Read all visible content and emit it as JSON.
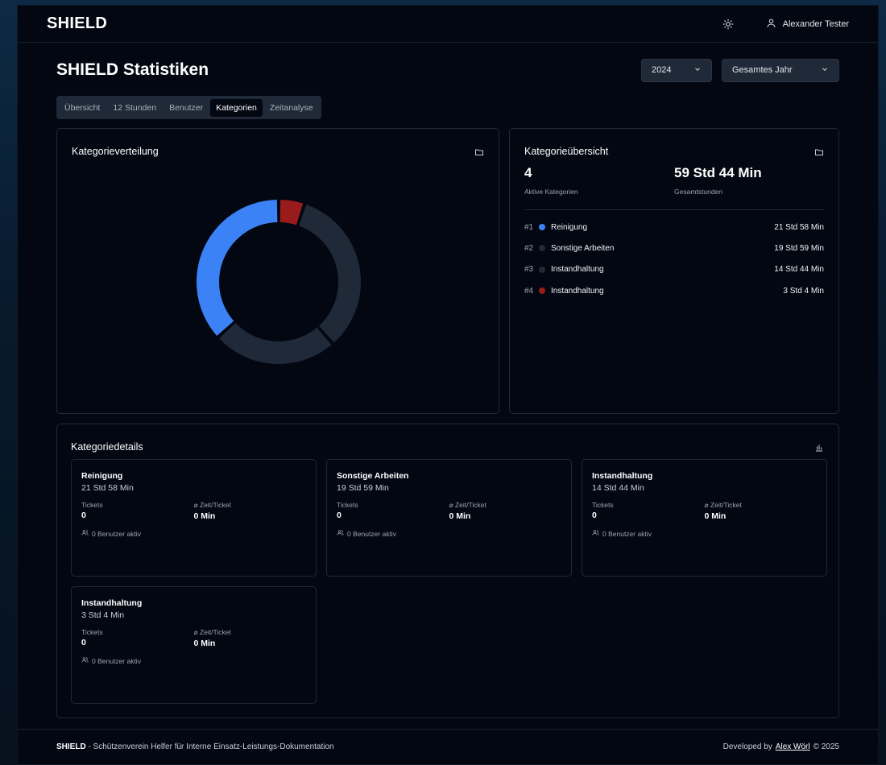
{
  "header": {
    "brand": "SHIELD",
    "user_name": "Alexander Tester"
  },
  "page": {
    "title": "SHIELD Statistiken"
  },
  "filters": {
    "year": "2024",
    "range": "Gesamtes Jahr"
  },
  "tabs": [
    {
      "label": "Übersicht"
    },
    {
      "label": "12 Stunden"
    },
    {
      "label": "Benutzer"
    },
    {
      "label": "Kategorien"
    },
    {
      "label": "Zeitanalyse"
    }
  ],
  "distribution": {
    "title": "Kategorieverteilung"
  },
  "overview": {
    "title": "Kategorieübersicht",
    "active_count": "4",
    "active_label": "Aktive Kategorien",
    "total_time": "59 Std 44 Min",
    "total_label": "Gesamtstunden",
    "items": [
      {
        "rank": "#1",
        "name": "Reinigung",
        "time": "21 Std 58 Min"
      },
      {
        "rank": "#2",
        "name": "Sonstige Arbeiten",
        "time": "19 Std 59 Min"
      },
      {
        "rank": "#3",
        "name": "Instandhaltung",
        "time": "14 Std 44 Min"
      },
      {
        "rank": "#4",
        "name": "Instandhaltung",
        "time": "3 Std 4 Min"
      }
    ]
  },
  "details": {
    "title": "Kategoriedetails",
    "tickets_label": "Tickets",
    "avg_label": "⌀ Zeit/Ticket",
    "cards": [
      {
        "name": "Reinigung",
        "time": "21 Std 58 Min",
        "tickets": "0",
        "avg": "0 Min",
        "users": "0 Benutzer aktiv"
      },
      {
        "name": "Sonstige Arbeiten",
        "time": "19 Std 59 Min",
        "tickets": "0",
        "avg": "0 Min",
        "users": "0 Benutzer aktiv"
      },
      {
        "name": "Instandhaltung",
        "time": "14 Std 44 Min",
        "tickets": "0",
        "avg": "0 Min",
        "users": "0 Benutzer aktiv"
      },
      {
        "name": "Instandhaltung",
        "time": "3 Std 4 Min",
        "tickets": "0",
        "avg": "0 Min",
        "users": "0 Benutzer aktiv"
      }
    ]
  },
  "chart_data": {
    "type": "pie",
    "categories": [
      "Reinigung",
      "Sonstige Arbeiten",
      "Instandhaltung",
      "Instandhaltung"
    ],
    "values": [
      1318,
      1199,
      884,
      184
    ],
    "colors": [
      "#3b82f6",
      "#1f2937",
      "#1f2937",
      "#991b1b"
    ],
    "title": "Kategorieverteilung"
  },
  "colors": {
    "accent": "#3b82f6",
    "muted": "#1f2937",
    "danger": "#991b1b",
    "background": "#030712"
  },
  "footer": {
    "brand": "SHIELD",
    "tagline": " - Schützenverein Helfer für Interne Einsatz-Leistungs-Dokumentation",
    "dev_prefix": "Developed by",
    "dev_name": "Alex Wörl",
    "copyright": "© 2025"
  }
}
